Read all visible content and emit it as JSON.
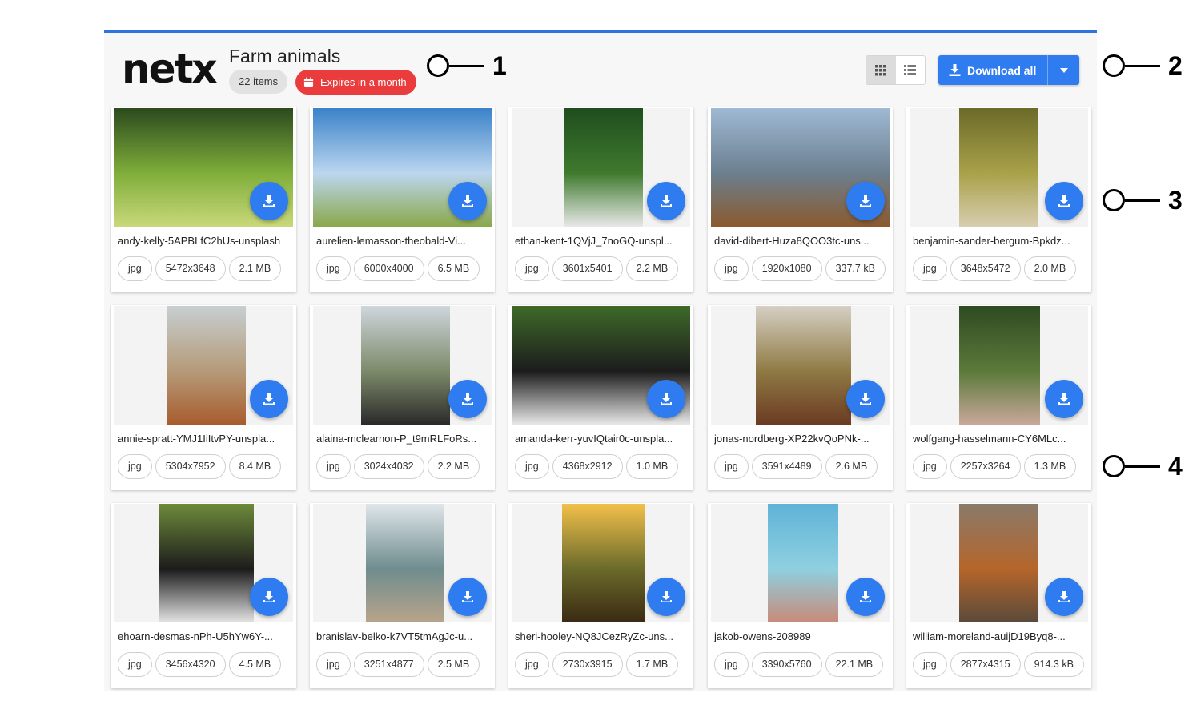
{
  "header": {
    "logo": "netx",
    "title": "Farm animals",
    "item_count": "22 items",
    "expires": "Expires in a month",
    "download_all_label": "Download all"
  },
  "colors": {
    "accent": "#2f7cf0",
    "top_bar": "#2f73e0",
    "expire_badge": "#ea3c3c"
  },
  "assets": [
    {
      "name": "andy-kelly-5APBLfC2hUs-unsplash",
      "type": "jpg",
      "dims": "5472x3648",
      "size": "2.1 MB",
      "palette": [
        "#2b4a1e",
        "#7fae3a",
        "#c9d87a"
      ]
    },
    {
      "name": "aurelien-lemasson-theobald-Vi...",
      "type": "jpg",
      "dims": "6000x4000",
      "size": "6.5 MB",
      "palette": [
        "#3a82c9",
        "#bcd6ef",
        "#8aa84a"
      ]
    },
    {
      "name": "ethan-kent-1QVjJ_7noGQ-unspl...",
      "type": "jpg",
      "dims": "3601x5401",
      "size": "2.2 MB",
      "palette": [
        "#1f4d1e",
        "#3f7a2e",
        "#e8e8e8"
      ]
    },
    {
      "name": "david-dibert-Huza8QOO3tc-uns...",
      "type": "jpg",
      "dims": "1920x1080",
      "size": "337.7 kB",
      "palette": [
        "#9fb9d4",
        "#6b7f8e",
        "#8a5a2e"
      ]
    },
    {
      "name": "benjamin-sander-bergum-Bpkdz...",
      "type": "jpg",
      "dims": "3648x5472",
      "size": "2.0 MB",
      "palette": [
        "#6b6a28",
        "#a9a24a",
        "#d8cdb0"
      ]
    },
    {
      "name": "annie-spratt-YMJ1IiItvPY-unspla...",
      "type": "jpg",
      "dims": "5304x7952",
      "size": "8.4 MB",
      "palette": [
        "#c7cfd2",
        "#b59a78",
        "#a85c2e"
      ]
    },
    {
      "name": "alaina-mclearnon-P_t9mRLFoRs...",
      "type": "jpg",
      "dims": "3024x4032",
      "size": "2.2 MB",
      "palette": [
        "#cfd6dc",
        "#7d8a6a",
        "#2a2a2a"
      ]
    },
    {
      "name": "amanda-kerr-yuvIQtair0c-unspla...",
      "type": "jpg",
      "dims": "4368x2912",
      "size": "1.0 MB",
      "palette": [
        "#3e6a2a",
        "#1c1c1c",
        "#e8e8e8"
      ]
    },
    {
      "name": "jonas-nordberg-XP22kvQoPNk-...",
      "type": "jpg",
      "dims": "3591x4489",
      "size": "2.6 MB",
      "palette": [
        "#d6d0c4",
        "#8f7a44",
        "#6b3a22"
      ]
    },
    {
      "name": "wolfgang-hasselmann-CY6MLc...",
      "type": "jpg",
      "dims": "2257x3264",
      "size": "1.3 MB",
      "palette": [
        "#2e4a22",
        "#5b7a3a",
        "#c9a79a"
      ]
    },
    {
      "name": "ehoarn-desmas-nPh-U5hYw6Y-...",
      "type": "jpg",
      "dims": "3456x4320",
      "size": "4.5 MB",
      "palette": [
        "#6d8a3a",
        "#1c1c1c",
        "#e4e4e4"
      ]
    },
    {
      "name": "branislav-belko-k7VT5tmAgJc-u...",
      "type": "jpg",
      "dims": "3251x4877",
      "size": "2.5 MB",
      "palette": [
        "#dfe6ea",
        "#6f8c8e",
        "#b8a48a"
      ]
    },
    {
      "name": "sheri-hooley-NQ8JCezRyZc-uns...",
      "type": "jpg",
      "dims": "2730x3915",
      "size": "1.7 MB",
      "palette": [
        "#f2c04a",
        "#6a6a2a",
        "#3a2a12"
      ]
    },
    {
      "name": "jakob-owens-208989",
      "type": "jpg",
      "dims": "3390x5760",
      "size": "22.1 MB",
      "palette": [
        "#5fb3d8",
        "#8fd0e0",
        "#c98a7a"
      ]
    },
    {
      "name": "william-moreland-auijD19Byq8-...",
      "type": "jpg",
      "dims": "2877x4315",
      "size": "914.3 kB",
      "palette": [
        "#8a7a6a",
        "#b5652a",
        "#5a4a3a"
      ]
    }
  ],
  "callouts": [
    "1",
    "2",
    "3",
    "4"
  ]
}
